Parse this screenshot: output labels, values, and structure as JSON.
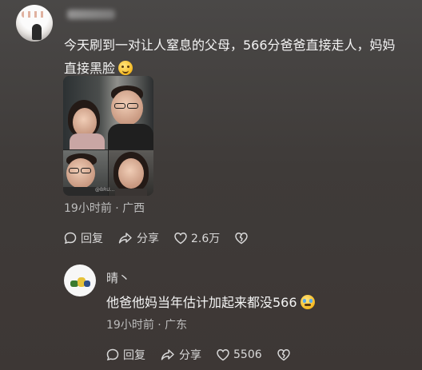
{
  "post": {
    "text_line1": "今天刷到一对让人窒息的父母，566分爸爸直接走人，妈妈",
    "text_line2": "直接黑脸",
    "meta": "19小时前 · 广西",
    "actions": {
      "reply": "回复",
      "share": "分享",
      "likes": "2.6万"
    },
    "image_watermark": "@BRU..."
  },
  "reply": {
    "name": "晴丶",
    "text": "他爸他妈当年估计加起来都没566",
    "meta": "19小时前 · 广东",
    "actions": {
      "reply": "回复",
      "share": "分享",
      "likes": "5506"
    }
  },
  "icons": [
    "comment-icon",
    "share-icon",
    "heart-icon",
    "heart-broken-icon",
    "grin-emoji-icon",
    "sweat-smile-emoji-icon"
  ]
}
